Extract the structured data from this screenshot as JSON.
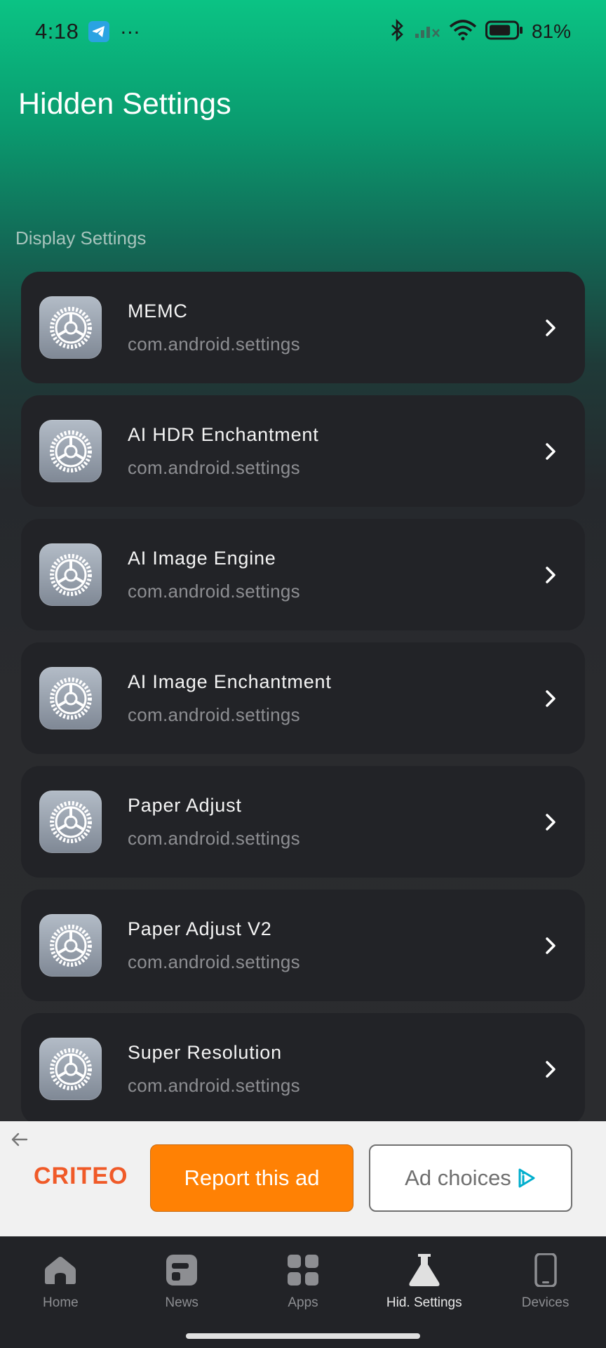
{
  "status_bar": {
    "time": "4:18",
    "battery_percent": "81%",
    "battery_level": 81
  },
  "header": {
    "title": "Hidden Settings"
  },
  "section": {
    "label": "Display Settings"
  },
  "items": [
    {
      "title": "MEMC",
      "package": "com.android.settings"
    },
    {
      "title": "AI HDR Enchantment",
      "package": "com.android.settings"
    },
    {
      "title": "AI Image Engine",
      "package": "com.android.settings"
    },
    {
      "title": "AI Image Enchantment",
      "package": "com.android.settings"
    },
    {
      "title": "Paper Adjust",
      "package": "com.android.settings"
    },
    {
      "title": "Paper Adjust V2",
      "package": "com.android.settings"
    },
    {
      "title": "Super Resolution",
      "package": "com.android.settings"
    }
  ],
  "ad": {
    "brand": "CRITEO",
    "report_label": "Report this ad",
    "choices_label": "Ad choices"
  },
  "nav": {
    "items": [
      {
        "label": "Home",
        "icon": "home-icon"
      },
      {
        "label": "News",
        "icon": "news-icon"
      },
      {
        "label": "Apps",
        "icon": "apps-icon"
      },
      {
        "label": "Hid. Settings",
        "icon": "flask-icon"
      },
      {
        "label": "Devices",
        "icon": "phone-icon"
      }
    ],
    "active": "Hid. Settings"
  },
  "colors": {
    "accent_green": "#0bc384",
    "card_bg": "#222327",
    "report_orange": "#ff8104",
    "criteo_orange": "#f05a28"
  }
}
